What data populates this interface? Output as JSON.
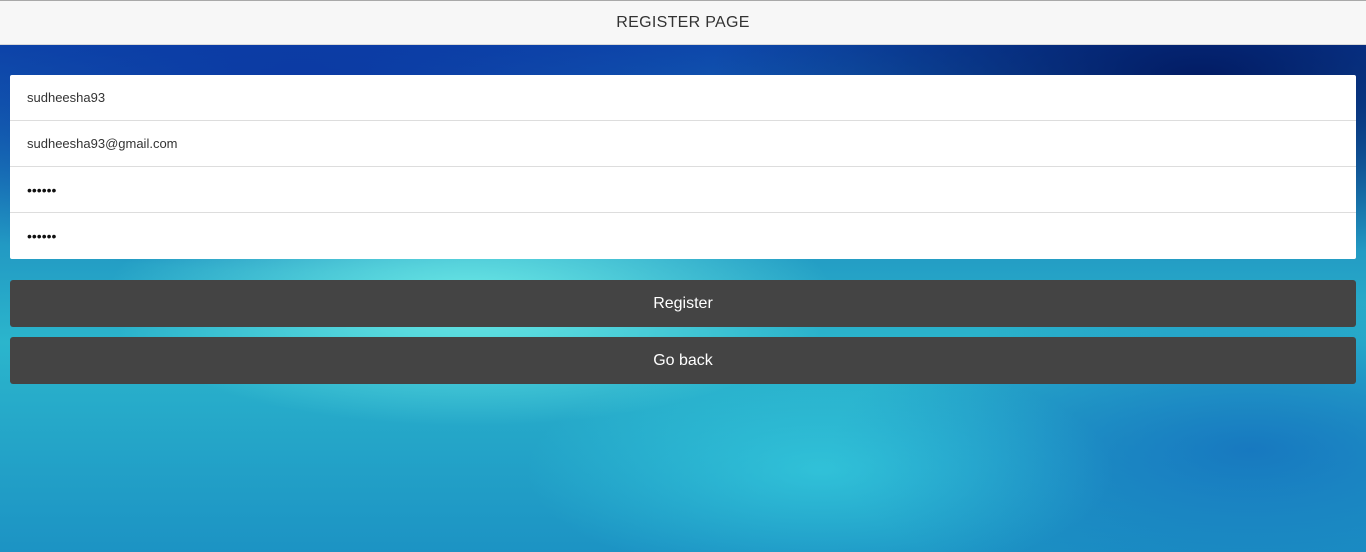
{
  "header": {
    "title": "REGISTER PAGE"
  },
  "form": {
    "username_value": "sudheesha93",
    "email_value": "sudheesha93@gmail.com",
    "password_value": "••••••",
    "confirm_password_value": "••••••"
  },
  "buttons": {
    "register_label": "Register",
    "back_label": "Go back"
  },
  "colors": {
    "header_bg": "#f7f7f7",
    "button_bg": "#444444",
    "button_text": "#ffffff",
    "form_bg": "#ffffff"
  }
}
